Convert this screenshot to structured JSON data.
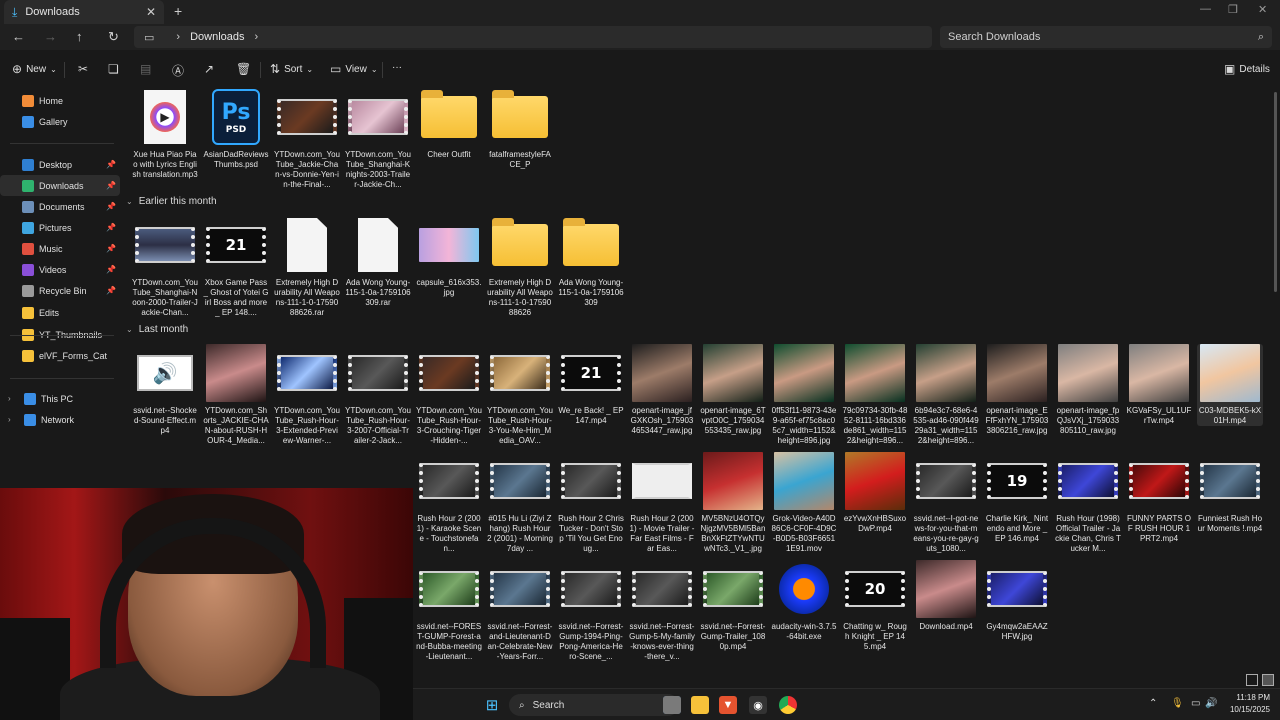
{
  "window": {
    "tab_title": "Downloads",
    "address": {
      "crumb": "Downloads"
    },
    "search_placeholder": "Search Downloads"
  },
  "toolbar": {
    "new_label": "New",
    "sort_label": "Sort",
    "view_label": "View",
    "more_label": "···",
    "details_label": "Details"
  },
  "sidebar": {
    "items": [
      {
        "label": "Home",
        "icon": "home-icon",
        "color": "#f28c38"
      },
      {
        "label": "Gallery",
        "icon": "gallery-icon",
        "color": "#3a8ee6"
      },
      {
        "label": "Desktop",
        "icon": "desktop-icon",
        "color": "#2f7fd1",
        "pinned": true
      },
      {
        "label": "Downloads",
        "icon": "downloads-icon",
        "color": "#2fb36e",
        "pinned": true,
        "selected": true
      },
      {
        "label": "Documents",
        "icon": "documents-icon",
        "color": "#6c8fb8",
        "pinned": true
      },
      {
        "label": "Pictures",
        "icon": "pictures-icon",
        "color": "#3fa6e0",
        "pinned": true
      },
      {
        "label": "Music",
        "icon": "music-icon",
        "color": "#e0503f",
        "pinned": true
      },
      {
        "label": "Videos",
        "icon": "videos-icon",
        "color": "#8a4fd8",
        "pinned": true
      },
      {
        "label": "Recycle Bin",
        "icon": "recycle-bin-icon",
        "color": "#9a9a9a",
        "pinned": true
      },
      {
        "label": "Edits",
        "icon": "folder-icon",
        "color": "#f6c13a"
      },
      {
        "label": "YT_Thumbnails",
        "icon": "folder-icon",
        "color": "#f6c13a"
      },
      {
        "label": "elVF_Forms_Cat",
        "icon": "folder-icon",
        "color": "#f6c13a"
      },
      {
        "label": "This PC",
        "icon": "this-pc-icon",
        "color": "#3a8ee6"
      },
      {
        "label": "Network",
        "icon": "network-icon",
        "color": "#3a8ee6"
      }
    ]
  },
  "groups": {
    "earlier_this_month": "Earlier this month",
    "last_month": "Last month"
  },
  "files": {
    "recent": [
      "Xue Hua Piao Piao with Lyrics English translation.mp3",
      "AsianDadReviews Thumbs.psd",
      "YTDown.com_YouTube_Jackie-Chan-vs-Donnie-Yen-in-the-Final-...",
      "YTDown.com_YouTube_Shanghai-Knights-2003-Trailer-Jackie-Ch...",
      "Cheer Outfit",
      "fatalframestyleFACE_P"
    ],
    "earlier": [
      "YTDown.com_YouTube_Shanghai-Noon-2000-Trailer-Jackie-Chan...",
      "Xbox Game Pass_ Ghost of Yotei Girl Boss and more _ EP 148....",
      "Extremely High Durability All Weapons-111-1-0-1759088626.rar",
      "Ada Wong Young-115-1-0a-1759106309.rar",
      "capsule_616x353.jpg",
      "Extremely High Durability All Weapons-111-1-0-1759088626",
      "Ada Wong Young-115-1-0a-1759106309"
    ],
    "last_month_row1": [
      "ssvid.net--Shocked-Sound-Effect.mp4",
      "YTDown.com_Shorts_JACKIE-CHAN-about-RUSH-HOUR-4_Media...",
      "YTDown.com_YouTube_Rush-Hour-3-Extended-Preview-Warner-...",
      "YTDown.com_YouTube_Rush-Hour-3-2007-Official-Trailer-2-Jack...",
      "YTDown.com_YouTube_Rush-Hour-3-Crouching-Tiger-Hidden-...",
      "YTDown.com_YouTube_Rush-Hour-3-You-Me-Him_Media_OAV...",
      "We_re Back! _ EP 147.mp4",
      "openart-image_jfGXKOsh_1759034653447_raw.jpg",
      "openart-image_6TvptO0C_1759034553435_raw.jpg",
      "0ff53f11-9873-43e9-a65f-ef75c8ac05c7_width=1152&height=896.jpg",
      "79c09734-30fb-4852-8111-16bd336de861_width=1152&height=896...",
      "6b94e3c7-68e6-4535-ad46-090f44929a31_width=1152&height=896...",
      "openart-image_EFfFxhYN_1759033806216_raw.jpg",
      "openart-image_fpQJsVXj_1759033805110_raw.jpg",
      "KGVaFSy_UL1UFrTw.mp4",
      "C03-MDBEK5-kX01H.mp4"
    ],
    "last_month_row2": [
      "Rush Hour 2 (2001) - Karaoke Scene - Touchstonefan...",
      "#015 Hu Li (Ziyi Zhang) Rush Hour 2 (2001) - Morning7day ...",
      "Rush Hour 2 Chris Tucker - Don't Stop 'Til You Get Enoug...",
      "Rush Hour 2 (2001) - Movie Trailer - Far East Films - Far Eas...",
      "MV5BNzU4OTQyNjgzMV5BMl5BanBnXkFtZTYwNTUwNTc3._V1_.jpg",
      "Grok-Video-A40D86C6-CF0F-4D9C-B0D5-B03F66511E91.mov",
      "ezYvwXnHBSuxoDwP.mp4",
      "ssvid.net--I-got-news-for-you-that-means-you-re-gay-guts_1080...",
      "Charlie Kirk_ Nintendo and More _ EP 146.mp4",
      "Rush Hour (1998) Official Trailer - Jackie Chan, Chris Tucker M...",
      "FUNNY PARTS OF RUSH HOUR 1 PRT2.mp4",
      "Funniest Rush Hour Moments !.mp4"
    ],
    "last_month_row3": [
      "ssvid.net--FOREST-GUMP-Forest-and-Bubba-meeting-Lieutenant...",
      "ssvid.net--Forrest-and-Lieutenant-Dan-Celebrate-New-Years-Forr...",
      "ssvid.net--Forrest-Gump-1994-Ping-Pong-America-Hero-Scene_...",
      "ssvid.net--Forrest-Gump-5-My-family-knows-ever-thing-there_v...",
      "ssvid.net--Forrest-Gump-Trailer_1080p.mp4",
      "audacity-win-3.7.5-64bit.exe",
      "Chatting w_ Rough Knight _ EP 145.mp4",
      "Download.mp4",
      "Gy4mqw2aEAAZHFW.jpg"
    ],
    "episode_numbers": {
      "ep21": "21",
      "ep19": "19",
      "ep20": "20"
    }
  },
  "taskbar": {
    "search_label": "Search",
    "time": "11:18 PM",
    "date": "10/15/2025"
  },
  "colors": {
    "accent": "#4cc2ff",
    "folder": "#f6c13a",
    "background": "#191919"
  }
}
